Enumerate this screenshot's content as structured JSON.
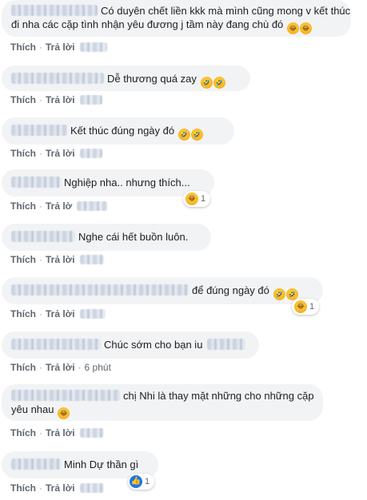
{
  "comments": [
    {
      "text_line1": "Có duyên chết liền kkk mà mình cũng mong v kết thúc",
      "text_line2": "đi nha các cặp tình nhận yêu đương j tầm này đang chù đó",
      "emojis": [
        "laugh",
        "laugh"
      ],
      "actions": {
        "like": "Thích",
        "reply": "Trả lời"
      }
    },
    {
      "text": "Dễ thương quá zay",
      "emojis": [
        "rofl",
        "rofl"
      ],
      "actions": {
        "like": "Thích",
        "reply": "Trả lời"
      }
    },
    {
      "text": "Kết thúc đúng ngày đó",
      "emojis": [
        "rofl",
        "rofl"
      ],
      "actions": {
        "like": "Thích",
        "reply": "Trả lời"
      }
    },
    {
      "text": "Nghiệp nha.. nhưng thích...",
      "actions": {
        "like": "Thích",
        "reply": "Trả lờ"
      },
      "reaction": {
        "emoji": "laugh",
        "count": "1"
      }
    },
    {
      "text": "Nghe cái hết buồn luôn.",
      "actions": {
        "like": "Thích",
        "reply": "Trả lời"
      }
    },
    {
      "text": "để đúng ngày đó",
      "emojis": [
        "rofl",
        "rofl"
      ],
      "actions": {
        "like": "Thích",
        "reply": "Trả lời"
      },
      "reaction": {
        "emoji": "laugh",
        "count": "1"
      }
    },
    {
      "text": "Chúc sớm cho bạn iu",
      "actions": {
        "like": "Thích",
        "reply": "Trả lời",
        "time": "6 phút"
      }
    },
    {
      "text_line1": "chị Nhi là thay mặt những cho những cặp",
      "text_line2": "yêu nhau",
      "emojis": [
        "laugh"
      ],
      "actions": {
        "like": "Thích",
        "reply": "Trả lời"
      }
    },
    {
      "text": "Minh Dự thần gì",
      "actions": {
        "like": "Thích",
        "reply": "Trả lời"
      },
      "reaction": {
        "emoji": "like",
        "count": "1"
      }
    }
  ],
  "emoji_glyphs": {
    "laugh": "😂",
    "rofl": "🤣",
    "like": "👍"
  }
}
